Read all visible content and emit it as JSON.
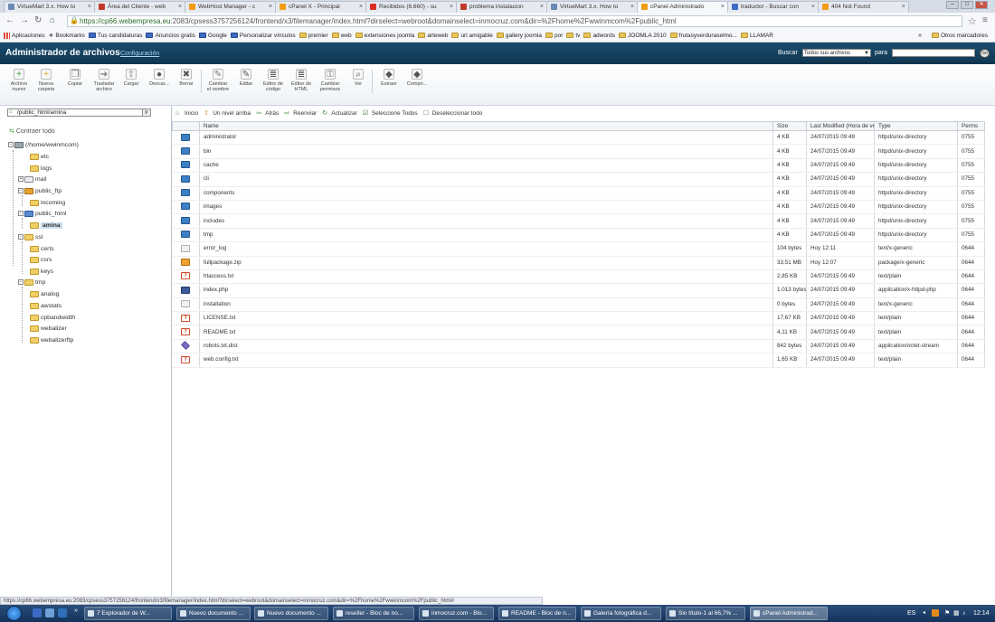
{
  "browser": {
    "tabs": [
      {
        "label": "VirtueMart 3.x. How to",
        "icon_color": "#6a8bb5"
      },
      {
        "label": "Área del Cliente - web",
        "icon_color": "#c0392b"
      },
      {
        "label": "WebHost Manager - c",
        "icon_color": "#f39c12"
      },
      {
        "label": "cPanel X - Principal",
        "icon_color": "#f39c12"
      },
      {
        "label": "Recibidos (8.660) - su",
        "icon_color": "#d93025"
      },
      {
        "label": "problema instalacion",
        "icon_color": "#c0392b"
      },
      {
        "label": "VirtueMart 3.x. How to",
        "icon_color": "#6a8bb5"
      },
      {
        "label": "cPanel Administrado",
        "icon_color": "#f39c12",
        "active": true
      },
      {
        "label": "traductor - Buscar con",
        "icon_color": "#3b6bc4"
      },
      {
        "label": "404 Not Found",
        "icon_color": "#f39c12"
      }
    ],
    "url_scheme": "https://",
    "url_host": "cp66.webempresa.eu",
    "url_rest": ":2083/cpsess3757256124/frontend/x3/filemanager/index.html?dirselect=webroot&domainselect=inmocruz.com&dir=%2Fhome%2Fwwinmcom%2Fpublic_html",
    "bookmarks": [
      {
        "label": "Aplicaciones",
        "type": "apps"
      },
      {
        "label": "Bookmarks",
        "type": "star"
      },
      {
        "label": "Tus candidaturas",
        "type": "blue"
      },
      {
        "label": "Anuncios gratis",
        "type": "blue"
      },
      {
        "label": "Google",
        "type": "blue"
      },
      {
        "label": "Personalizar vínculos",
        "type": "blue"
      },
      {
        "label": "premier",
        "type": "folder"
      },
      {
        "label": "web",
        "type": "folder"
      },
      {
        "label": "extensiones joomla",
        "type": "folder"
      },
      {
        "label": "arteweb",
        "type": "folder"
      },
      {
        "label": "url amigable",
        "type": "folder"
      },
      {
        "label": "gallery joomla",
        "type": "folder"
      },
      {
        "label": "por",
        "type": "folder"
      },
      {
        "label": "tv",
        "type": "folder"
      },
      {
        "label": "adwords",
        "type": "folder"
      },
      {
        "label": "JOOMLA 2010",
        "type": "folder"
      },
      {
        "label": "frutasyverduraselmo...",
        "type": "folder"
      },
      {
        "label": "LLAMAR",
        "type": "folder"
      }
    ],
    "bookmarks_more": "»",
    "other_bookmarks": "Otros marcadores"
  },
  "cpanel": {
    "title": "Administrador de archivos",
    "config_link": "Configuración",
    "search_label": "Buscar",
    "search_scope": "Todos sus archivos",
    "para_label": "para",
    "go_label": "Go"
  },
  "toolbar": [
    {
      "label": "Archivo nuevo",
      "icon": "new-file-icon",
      "glyph": "+",
      "color": "#3a9a3a"
    },
    {
      "label": "Nueva carpeta",
      "icon": "new-folder-icon",
      "glyph": "+",
      "color": "#e0a820"
    },
    {
      "label": "Copiar",
      "icon": "copy-icon",
      "glyph": "❐",
      "color": "#777"
    },
    {
      "label": "Trasladar archivo",
      "icon": "move-file-icon",
      "glyph": "➔",
      "color": "#777"
    },
    {
      "label": "Cargar",
      "icon": "upload-icon",
      "glyph": "⇧",
      "color": "#777"
    },
    {
      "label": "Descar...",
      "icon": "download-icon",
      "glyph": "●",
      "color": "#555"
    },
    {
      "label": "Borrar",
      "icon": "delete-icon",
      "glyph": "✖",
      "color": "#555"
    },
    {
      "label": "Cambiar el nombre",
      "icon": "rename-icon",
      "glyph": "✎",
      "color": "#777"
    },
    {
      "label": "Editar",
      "icon": "edit-icon",
      "glyph": "✎",
      "color": "#555"
    },
    {
      "label": "Editor de código",
      "icon": "code-editor-icon",
      "glyph": "≣",
      "color": "#555"
    },
    {
      "label": "Editor de HTML",
      "icon": "html-editor-icon",
      "glyph": "≣",
      "color": "#555"
    },
    {
      "label": "Cambiar permisos",
      "icon": "permissions-icon",
      "glyph": "⚿",
      "color": "#777"
    },
    {
      "label": "Ver",
      "icon": "view-icon",
      "glyph": "⌕",
      "color": "#555"
    },
    {
      "label": "Extraer",
      "icon": "extract-icon",
      "glyph": "◆",
      "color": "#555"
    },
    {
      "label": "Compri...",
      "icon": "compress-icon",
      "glyph": "◆",
      "color": "#555"
    }
  ],
  "left_pane": {
    "path_value": "/public_html/amina",
    "go_label": "Ir",
    "collapse_all": "Contraer todo",
    "tree": [
      {
        "label": "(/home/wwinmcom)",
        "icon": "home-folder-icon",
        "exp": "−"
      },
      {
        "label": "etc",
        "icon": "folder-icon"
      },
      {
        "label": "logs",
        "icon": "folder-icon"
      },
      {
        "label": "mail",
        "icon": "mail-folder-icon",
        "exp": "+"
      },
      {
        "label": "public_ftp",
        "icon": "ftp-folder-icon",
        "exp": "−"
      },
      {
        "label": "incoming",
        "icon": "folder-icon"
      },
      {
        "label": "public_html",
        "icon": "web-folder-icon",
        "exp": "−"
      },
      {
        "label": "amina",
        "icon": "folder-icon",
        "selected": true
      },
      {
        "label": "ssl",
        "icon": "folder-icon",
        "exp": "−"
      },
      {
        "label": "certs",
        "icon": "folder-icon"
      },
      {
        "label": "csrs",
        "icon": "folder-icon"
      },
      {
        "label": "keys",
        "icon": "folder-icon"
      },
      {
        "label": "tmp",
        "icon": "folder-icon",
        "exp": "−"
      },
      {
        "label": "analog",
        "icon": "folder-icon"
      },
      {
        "label": "awstats",
        "icon": "folder-icon"
      },
      {
        "label": "cpbandwidth",
        "icon": "folder-icon"
      },
      {
        "label": "webalizer",
        "icon": "folder-icon"
      },
      {
        "label": "webalizerftp",
        "icon": "folder-icon"
      }
    ]
  },
  "nav": [
    {
      "label": "Inicio",
      "icon": "home-icon",
      "glyph": "⌂",
      "color": "#3a8a3a"
    },
    {
      "label": "Un nivel arriba",
      "icon": "up-level-icon",
      "glyph": "⇧",
      "color": "#c89a20"
    },
    {
      "label": "Atrás",
      "icon": "back-icon",
      "glyph": "⇦",
      "color": "#3a8a3a"
    },
    {
      "label": "Reenviar",
      "icon": "forward-icon",
      "glyph": "⇨",
      "color": "#3a8a3a"
    },
    {
      "label": "Actualizar",
      "icon": "refresh-icon",
      "glyph": "↻",
      "color": "#3a8a3a"
    },
    {
      "label": "Seleccione Todos",
      "icon": "select-all-icon",
      "glyph": "☑",
      "color": "#3a6a3a"
    },
    {
      "label": "Deseleccionar todo",
      "icon": "deselect-all-icon",
      "glyph": "☐",
      "color": "#777"
    }
  ],
  "table": {
    "columns": [
      "",
      "Name",
      "Size",
      "Last Modified (Hora de ve",
      "Type",
      "Perms"
    ],
    "rows": [
      {
        "kind": "dir",
        "name": "administrator",
        "size": "4 KB",
        "modified": "24/07/2015 09:49",
        "type": "httpd/unix-directory",
        "perms": "0755"
      },
      {
        "kind": "dir",
        "name": "bin",
        "size": "4 KB",
        "modified": "24/07/2015 09:49",
        "type": "httpd/unix-directory",
        "perms": "0755"
      },
      {
        "kind": "dir",
        "name": "cache",
        "size": "4 KB",
        "modified": "24/07/2015 09:49",
        "type": "httpd/unix-directory",
        "perms": "0755"
      },
      {
        "kind": "dir",
        "name": "cli",
        "size": "4 KB",
        "modified": "24/07/2015 09:49",
        "type": "httpd/unix-directory",
        "perms": "0755"
      },
      {
        "kind": "dir",
        "name": "components",
        "size": "4 KB",
        "modified": "24/07/2015 09:49",
        "type": "httpd/unix-directory",
        "perms": "0755"
      },
      {
        "kind": "dir",
        "name": "images",
        "size": "4 KB",
        "modified": "24/07/2015 09:49",
        "type": "httpd/unix-directory",
        "perms": "0755"
      },
      {
        "kind": "dir",
        "name": "includes",
        "size": "4 KB",
        "modified": "24/07/2015 09:49",
        "type": "httpd/unix-directory",
        "perms": "0755"
      },
      {
        "kind": "dir",
        "name": "tmp",
        "size": "4 KB",
        "modified": "24/07/2015 09:49",
        "type": "httpd/unix-directory",
        "perms": "0755"
      },
      {
        "kind": "gen",
        "name": "error_log",
        "size": "104 bytes",
        "modified": "Hoy 12:11",
        "type": "text/x-generic",
        "perms": "0644"
      },
      {
        "kind": "zip",
        "name": "fullpackage.zip",
        "size": "33,51 MB",
        "modified": "Hoy 12:07",
        "type": "package/x-generic",
        "perms": "0644"
      },
      {
        "kind": "txt",
        "name": "htaccess.txt",
        "size": "2,85 KB",
        "modified": "24/07/2015 09:49",
        "type": "text/plain",
        "perms": "0644"
      },
      {
        "kind": "php",
        "name": "index.php",
        "size": "1.013 bytes",
        "modified": "24/07/2015 09:49",
        "type": "application/x-httpd-php",
        "perms": "0644"
      },
      {
        "kind": "gen",
        "name": "installation",
        "size": "0 bytes",
        "modified": "24/07/2015 09:49",
        "type": "text/x-generic",
        "perms": "0644"
      },
      {
        "kind": "txt",
        "name": "LICENSE.txt",
        "size": "17,67 KB",
        "modified": "24/07/2015 09:49",
        "type": "text/plain",
        "perms": "0644"
      },
      {
        "kind": "txt",
        "name": "README.txt",
        "size": "4,11 KB",
        "modified": "24/07/2015 09:49",
        "type": "text/plain",
        "perms": "0644"
      },
      {
        "kind": "bin",
        "name": "robots.txt.dist",
        "size": "842 bytes",
        "modified": "24/07/2015 09:49",
        "type": "application/octet-stream",
        "perms": "0644"
      },
      {
        "kind": "txt",
        "name": "web.config.txt",
        "size": "1,65 KB",
        "modified": "24/07/2015 09:49",
        "type": "text/plain",
        "perms": "0644"
      }
    ]
  },
  "status_url": "https://cp66.webempresa.eu:2083/cpsess3757256124/frontend/x3/filemanager/index.html?dirselect=webroot&domainselect=inmocruz.com&dir=%2Fhome%2Fwwinmcom%2Fpublic_html#",
  "taskbar": {
    "items": [
      {
        "label": "7 Explorador de W..."
      },
      {
        "label": "Nuevo documento ..."
      },
      {
        "label": "Nuevo documento ..."
      },
      {
        "label": "reseller - Bloc de no..."
      },
      {
        "label": "inmocruz.com - Blo..."
      },
      {
        "label": "README - Bloc de n..."
      },
      {
        "label": "Galería fotográfica d..."
      },
      {
        "label": "Sin título-1 al 66,7% ..."
      },
      {
        "label": "cPanel Administrad...",
        "active": true
      }
    ],
    "lang": "ES",
    "clock": "12:14"
  }
}
